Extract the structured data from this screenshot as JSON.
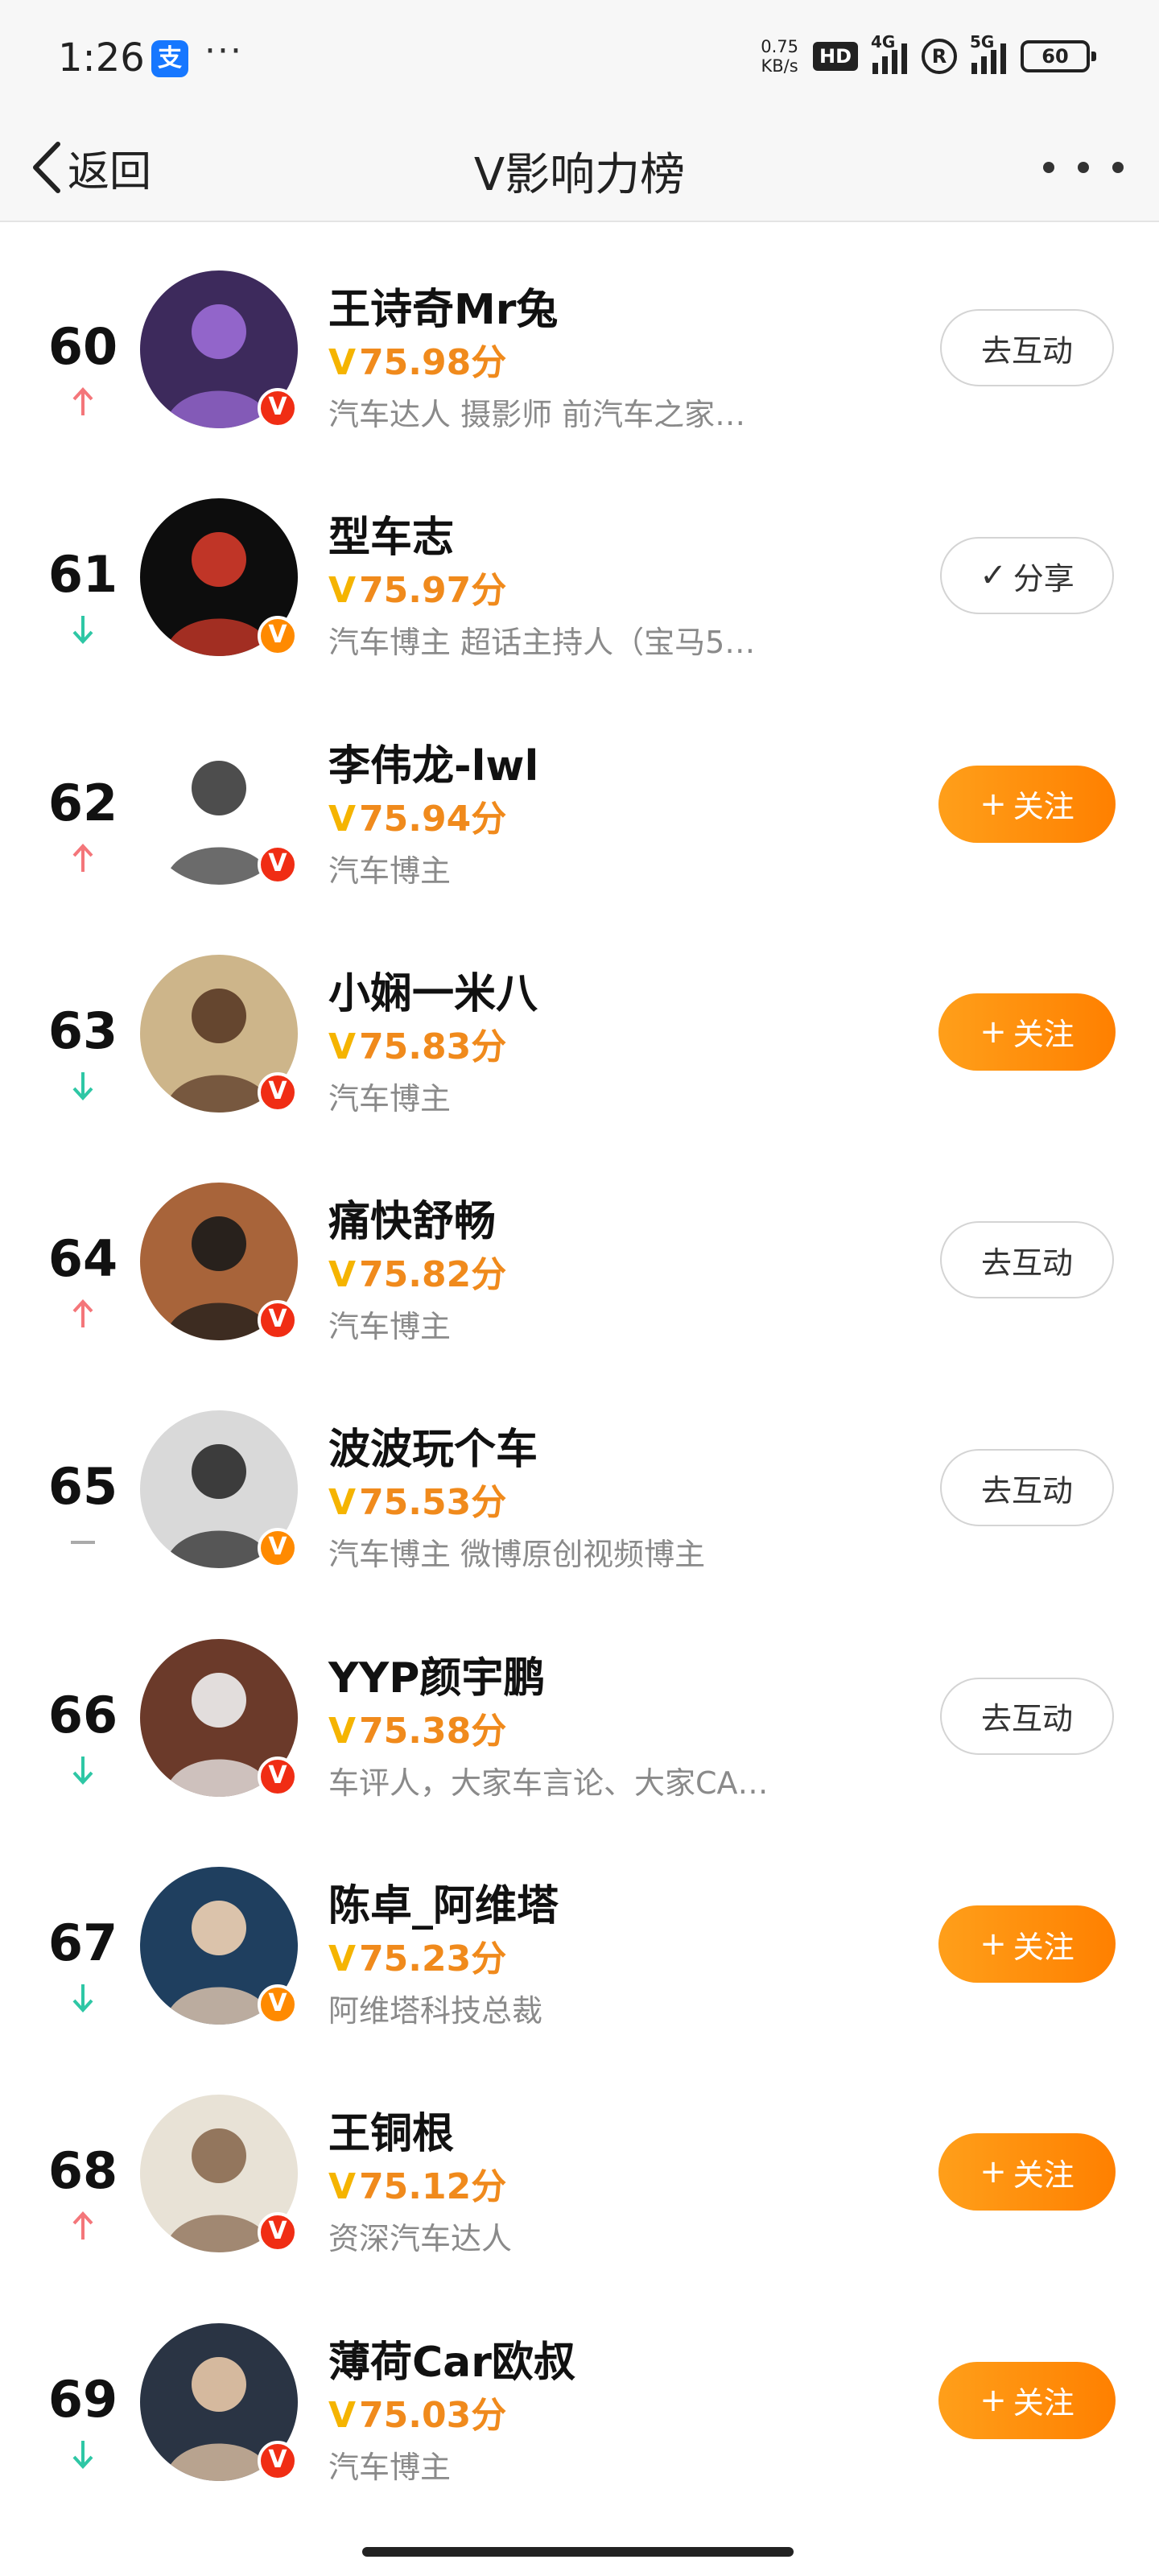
{
  "status_bar": {
    "time": "1:26",
    "app_icon": "支",
    "more_dots": "···",
    "net_speed_value": "0.75",
    "net_speed_unit": "KB/s",
    "hd": "HD",
    "signal_1": "4G",
    "signal_2": "5G",
    "r_badge": "R",
    "battery": "60"
  },
  "nav": {
    "back_label": "返回",
    "title": "V影响力榜"
  },
  "colors": {
    "score_orange": "#f08a1c",
    "v_gold": "#f5b400",
    "follow_orange": "#ff8a00",
    "up_arrow": "#f4767a",
    "down_arrow": "#2ec7a5",
    "same_dash": "#aaaaaa"
  },
  "list": [
    {
      "rank": "60",
      "trend": "up",
      "name": "王诗奇Mr兔",
      "v": "V",
      "score": "75.98分",
      "desc": "汽车达人 摄影师 前汽车之家…",
      "badge": "red",
      "button": {
        "type": "outline",
        "prefix": "",
        "label": "去互动"
      },
      "avatar": {
        "bg": "#3d2a5c",
        "fg": "#9b6bd6"
      }
    },
    {
      "rank": "61",
      "trend": "down",
      "name": "型车志",
      "v": "V",
      "score": "75.97分",
      "desc": "汽车博主 超话主持人（宝马5…",
      "badge": "orange",
      "button": {
        "type": "outline",
        "prefix": "✓",
        "label": "分享"
      },
      "avatar": {
        "bg": "#0d0d0d",
        "fg": "#d43a2a"
      }
    },
    {
      "rank": "62",
      "trend": "up",
      "name": "李伟龙-lwl",
      "v": "V",
      "score": "75.94分",
      "desc": "汽车博主",
      "badge": "red",
      "button": {
        "type": "follow",
        "prefix": "+",
        "label": "关注"
      },
      "avatar": {
        "bg": "#ffffff",
        "fg": "#3a3a3a"
      }
    },
    {
      "rank": "63",
      "trend": "down",
      "name": "小娴一米八",
      "v": "V",
      "score": "75.83分",
      "desc": "汽车博主",
      "badge": "red",
      "button": {
        "type": "follow",
        "prefix": "+",
        "label": "关注"
      },
      "avatar": {
        "bg": "#cdb58a",
        "fg": "#5a3a25"
      }
    },
    {
      "rank": "64",
      "trend": "up",
      "name": "痛快舒畅",
      "v": "V",
      "score": "75.82分",
      "desc": "汽车博主",
      "badge": "red",
      "button": {
        "type": "outline",
        "prefix": "",
        "label": "去互动"
      },
      "avatar": {
        "bg": "#a8643a",
        "fg": "#1a1a1a"
      }
    },
    {
      "rank": "65",
      "trend": "same",
      "name": "波波玩个车",
      "v": "V",
      "score": "75.53分",
      "desc": "汽车博主 微博原创视频博主",
      "badge": "orange",
      "button": {
        "type": "outline",
        "prefix": "",
        "label": "去互动"
      },
      "avatar": {
        "bg": "#d9d9d9",
        "fg": "#2a2a2a"
      }
    },
    {
      "rank": "66",
      "trend": "down",
      "name": "YYP颜宇鹏",
      "v": "V",
      "score": "75.38分",
      "desc": "车评人，大家车言论、大家CA…",
      "badge": "red",
      "button": {
        "type": "outline",
        "prefix": "",
        "label": "去互动"
      },
      "avatar": {
        "bg": "#6b3a2a",
        "fg": "#efefef"
      }
    },
    {
      "rank": "67",
      "trend": "down",
      "name": "陈卓_阿维塔",
      "v": "V",
      "score": "75.23分",
      "desc": "阿维塔科技总裁",
      "badge": "orange",
      "button": {
        "type": "follow",
        "prefix": "+",
        "label": "关注"
      },
      "avatar": {
        "bg": "#1f3f5f",
        "fg": "#f0d2b4"
      }
    },
    {
      "rank": "68",
      "trend": "up",
      "name": "王铜根",
      "v": "V",
      "score": "75.12分",
      "desc": "资深汽车达人",
      "badge": "red",
      "button": {
        "type": "follow",
        "prefix": "+",
        "label": "关注"
      },
      "avatar": {
        "bg": "#e8e2d6",
        "fg": "#8a6a50"
      }
    },
    {
      "rank": "69",
      "trend": "down",
      "name": "薄荷Car欧叔",
      "v": "V",
      "score": "75.03分",
      "desc": "汽车博主",
      "badge": "red",
      "button": {
        "type": "follow",
        "prefix": "+",
        "label": "关注"
      },
      "avatar": {
        "bg": "#2a3444",
        "fg": "#e8c8a8"
      }
    }
  ]
}
